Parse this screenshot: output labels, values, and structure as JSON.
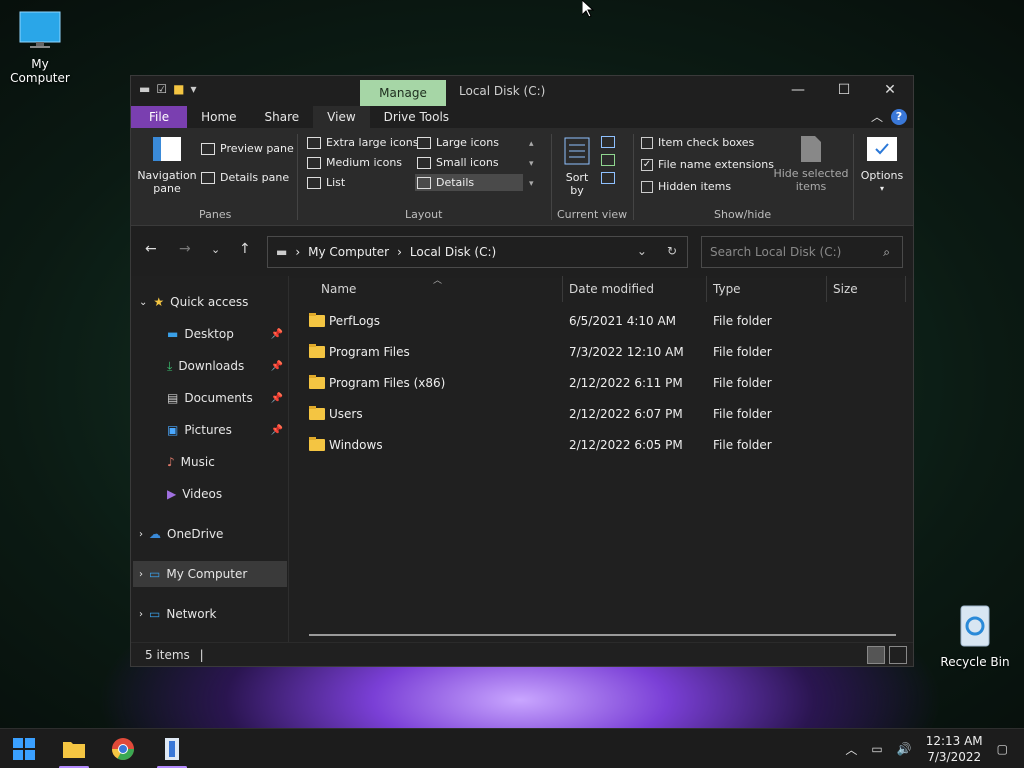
{
  "desktop": {
    "my_computer": "My Computer",
    "recycle_bin": "Recycle Bin"
  },
  "window": {
    "manage_tab": "Manage",
    "title": "Local Disk (C:)",
    "tabs": [
      "File",
      "Home",
      "Share",
      "View",
      "Drive Tools"
    ],
    "controls": {
      "minimize": "—",
      "maximize": "☐",
      "close": "✕"
    }
  },
  "ribbon": {
    "panes": {
      "navigation_pane": "Navigation pane",
      "preview_pane": "Preview pane",
      "details_pane": "Details pane",
      "label": "Panes"
    },
    "layout": {
      "label": "Layout",
      "options": [
        "Extra large icons",
        "Large icons",
        "Medium icons",
        "Small icons",
        "List",
        "Details"
      ],
      "selected": "Details"
    },
    "current_view": {
      "label": "Current view",
      "sort_by": "Sort by"
    },
    "show_hide": {
      "label": "Show/hide",
      "item_check_boxes": "Item check boxes",
      "file_name_extensions": "File name extensions",
      "hidden_items": "Hidden items",
      "hide_selected_items": "Hide selected items"
    },
    "options": "Options"
  },
  "address": {
    "crumbs": [
      "My Computer",
      "Local Disk (C:)"
    ],
    "search_placeholder": "Search Local Disk (C:)"
  },
  "nav": {
    "quick_access": "Quick access",
    "items": [
      "Desktop",
      "Downloads",
      "Documents",
      "Pictures",
      "Music",
      "Videos"
    ],
    "onedrive": "OneDrive",
    "my_computer": "My Computer",
    "network": "Network"
  },
  "columns": [
    "Name",
    "Date modified",
    "Type",
    "Size"
  ],
  "files": [
    {
      "name": "PerfLogs",
      "date": "6/5/2021 4:10 AM",
      "type": "File folder"
    },
    {
      "name": "Program Files",
      "date": "7/3/2022 12:10 AM",
      "type": "File folder"
    },
    {
      "name": "Program Files (x86)",
      "date": "2/12/2022 6:11 PM",
      "type": "File folder"
    },
    {
      "name": "Users",
      "date": "2/12/2022 6:07 PM",
      "type": "File folder"
    },
    {
      "name": "Windows",
      "date": "2/12/2022 6:05 PM",
      "type": "File folder"
    }
  ],
  "status": {
    "count": "5 items"
  },
  "taskbar": {
    "time": "12:13 AM",
    "date": "7/3/2022"
  },
  "colors": {
    "file_tab": "#7a3fb0",
    "manage_tab": "#a6d6a6",
    "folder": "#f4c542",
    "taskbar": "#1c1c1c"
  }
}
